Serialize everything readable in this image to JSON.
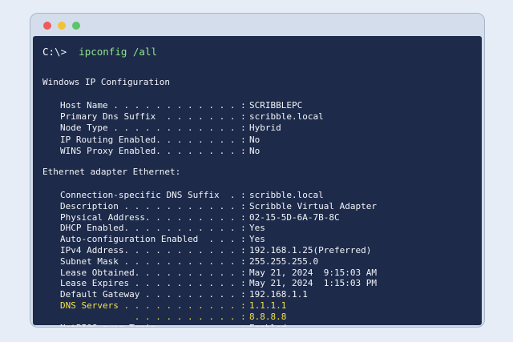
{
  "window": {
    "buttons": [
      "close",
      "minimize",
      "maximize"
    ]
  },
  "terminal": {
    "prompt": "C:\\>",
    "command": "ipconfig /all",
    "sections": [
      {
        "heading": "Windows IP Configuration",
        "rows": [
          {
            "label": "Host Name . . . . . . . . . . . . :",
            "value": "SCRIBBLEPC"
          },
          {
            "label": "Primary Dns Suffix  . . . . . . . :",
            "value": "scribble.local"
          },
          {
            "label": "Node Type . . . . . . . . . . . . :",
            "value": "Hybrid"
          },
          {
            "label": "IP Routing Enabled. . . . . . . . :",
            "value": "No"
          },
          {
            "label": "WINS Proxy Enabled. . . . . . . . :",
            "value": "No"
          }
        ]
      },
      {
        "heading": "Ethernet adapter Ethernet:",
        "rows": [
          {
            "label": "Connection-specific DNS Suffix  . :",
            "value": "scribble.local"
          },
          {
            "label": "Description . . . . . . . . . . . :",
            "value": "Scribble Virtual Adapter"
          },
          {
            "label": "Physical Address. . . . . . . . . :",
            "value": "02-15-5D-6A-7B-8C"
          },
          {
            "label": "DHCP Enabled. . . . . . . . . . . :",
            "value": "Yes"
          },
          {
            "label": "Auto-configuration Enabled  . . . :",
            "value": "Yes"
          },
          {
            "label": "IPv4 Address. . . . . . . . . . . :",
            "value": "192.168.1.25(Preferred)"
          },
          {
            "label": "Subnet Mask . . . . . . . . . . . :",
            "value": "255.255.255.0"
          },
          {
            "label": "Lease Obtained. . . . . . . . . . :",
            "value": "May 21, 2024  9:15:03 AM"
          },
          {
            "label": "Lease Expires . . . . . . . . . . :",
            "value": "May 21, 2024  1:15:03 PM"
          },
          {
            "label": "Default Gateway . . . . . . . . . :",
            "value": "192.168.1.1"
          },
          {
            "label": "DNS Servers . . . . . . . . . . . :",
            "value": "1.1.1.1",
            "highlight": true
          },
          {
            "label": "              . . . . . . . . . . :",
            "value": "8.8.8.8",
            "highlight": true
          },
          {
            "label": "NetBIOS over Tcpip. . . . . . . . :",
            "value": "Enabled"
          }
        ]
      }
    ]
  },
  "colors": {
    "terminal_bg": "#1d2a4a",
    "command": "#8ee68a",
    "highlight": "#f2e24a",
    "text": "#f2f4f8"
  }
}
